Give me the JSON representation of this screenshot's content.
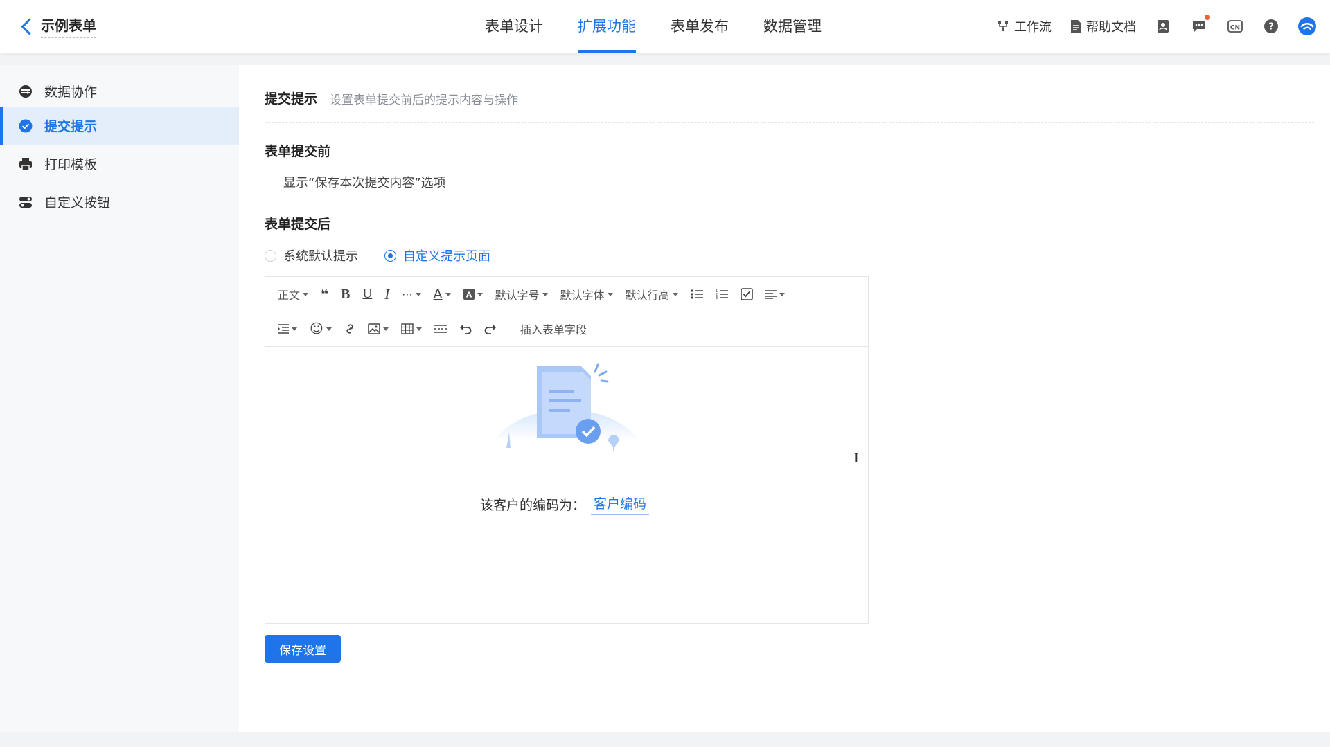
{
  "header": {
    "back_title": "示例表单",
    "tabs": [
      {
        "label": "表单设计"
      },
      {
        "label": "扩展功能"
      },
      {
        "label": "表单发布"
      },
      {
        "label": "数据管理"
      }
    ],
    "workflow_label": "工作流",
    "help_label": "帮助文档",
    "accent": "#1e74e8"
  },
  "sidebar": {
    "items": [
      {
        "label": "数据协作",
        "icon": "collaboration-icon"
      },
      {
        "label": "提交提示",
        "icon": "check-circle-icon"
      },
      {
        "label": "打印模板",
        "icon": "printer-icon"
      },
      {
        "label": "自定义按钮",
        "icon": "toggle-icon"
      }
    ]
  },
  "main": {
    "title": "提交提示",
    "description": "设置表单提交前后的提示内容与操作",
    "before": {
      "heading": "表单提交前",
      "checkbox_label": "显示“保存本次提交内容”选项",
      "checked": false
    },
    "after": {
      "heading": "表单提交后",
      "option_default": "系统默认提示",
      "option_custom": "自定义提示页面",
      "selected": "自定义提示页面"
    },
    "toolbar": {
      "paragraph": "正文",
      "more": "···",
      "font_size": "默认字号",
      "font_family": "默认字体",
      "line_height": "默认行高",
      "insert_field": "插入表单字段"
    },
    "editor": {
      "text": "该客户的编码为：",
      "field_tag": "客户编码"
    },
    "save_label": "保存设置"
  }
}
